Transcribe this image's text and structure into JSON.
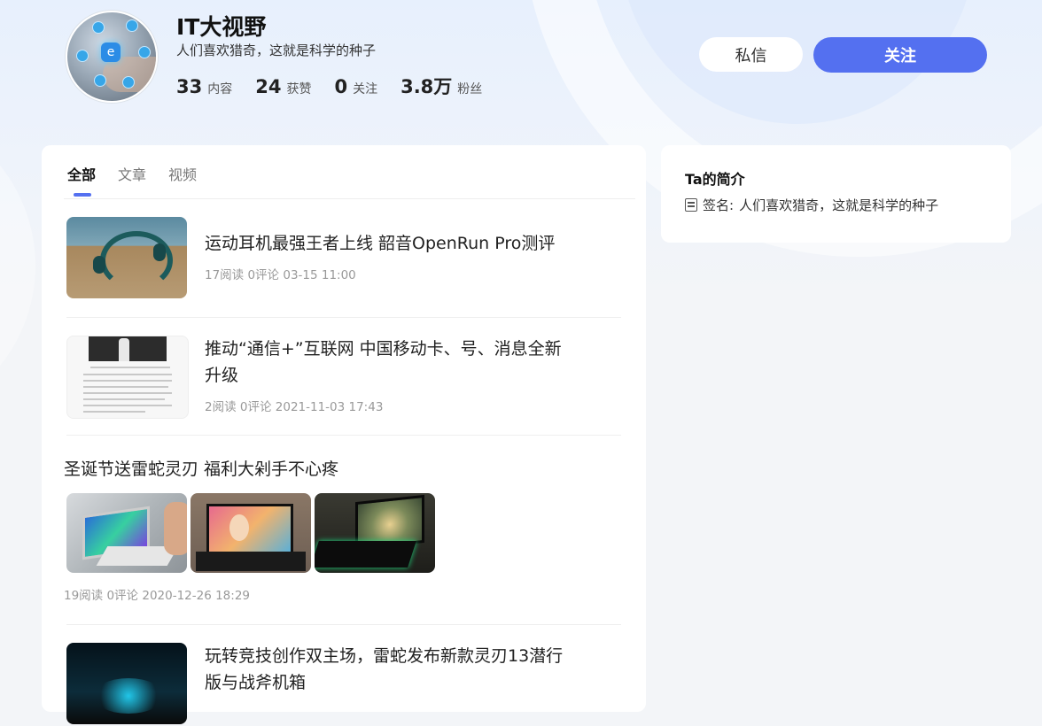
{
  "profile": {
    "name": "IT大视野",
    "tagline": "人们喜欢猎奇，这就是科学的种子",
    "stats": [
      {
        "num": "33",
        "label": "内容"
      },
      {
        "num": "24",
        "label": "获赞"
      },
      {
        "num": "0",
        "label": "关注"
      },
      {
        "num": "3.8万",
        "label": "粉丝"
      }
    ]
  },
  "actions": {
    "message_label": "私信",
    "follow_label": "关注"
  },
  "tabs": [
    {
      "label": "全部",
      "active": true
    },
    {
      "label": "文章",
      "active": false
    },
    {
      "label": "视频",
      "active": false
    }
  ],
  "articles": [
    {
      "title": "运动耳机最强王者上线 韶音OpenRun Pro测评",
      "meta": "17阅读  0评论  03-15 11:00",
      "thumb": "headphones"
    },
    {
      "title": "推动“通信+”互联网 中国移动卡、号、消息全新升级",
      "meta": "2阅读  0评论  2021-11-03 17:43",
      "thumb": "document"
    },
    {
      "title": "圣诞节送雷蛇灵刃 福利大剁手不心疼",
      "meta": "19阅读  0评论  2020-12-26 18:29",
      "thumb": "laptops"
    },
    {
      "title": "玩转竞技创作双主场，雷蛇发布新款灵刃13潜行版与战斧机箱",
      "meta": "",
      "thumb": "dark"
    }
  ],
  "about": {
    "title": "Ta的简介",
    "signature_label": "签名:",
    "signature": "人们喜欢猎奇，这就是科学的种子"
  },
  "colors": {
    "accent": "#5470f0",
    "background": "#f3f5f8"
  }
}
